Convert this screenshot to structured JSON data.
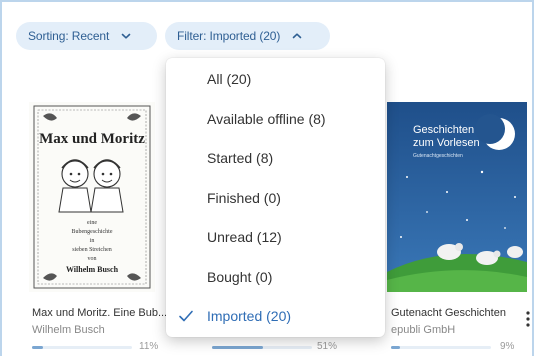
{
  "toolbar": {
    "sort_label": "Sorting: Recent",
    "filter_label": "Filter: Imported (20)"
  },
  "filter_menu": {
    "items": [
      {
        "label": "All (20)"
      },
      {
        "label": "Available offline (8)"
      },
      {
        "label": "Started (8)"
      },
      {
        "label": "Finished (0)"
      },
      {
        "label": "Unread (12)"
      },
      {
        "label": "Bought (0)"
      },
      {
        "label": "Imported (20)",
        "selected": true
      }
    ]
  },
  "books": [
    {
      "title": "Max und Moritz. Eine Bub...",
      "author": "Wilhelm Busch",
      "progress": 0.11,
      "progress_text": "11%",
      "cover": {
        "title": "Max und Moritz",
        "subtitle_lines": [
          "eine",
          "Bubengeschichte",
          "in",
          "sieben Streichen",
          "von"
        ],
        "author": "Wilhelm Busch"
      }
    },
    {
      "title": "",
      "author": "",
      "progress": 0.51,
      "progress_text": "51%"
    },
    {
      "title": "Gutenacht Geschichten",
      "author": "epubli GmbH",
      "progress": 0.09,
      "progress_text": "9%",
      "cover": {
        "title_lines": [
          "Geschichten",
          "zum Vorlesen"
        ],
        "subtitle": "Gutenachtgeschichten"
      }
    }
  ],
  "colors": {
    "accent": "#2f6db5",
    "chip_bg": "#e3eef9",
    "chip_text": "#2f5f93",
    "frame_border": "#bcd5ec",
    "progress_fill": "#7ba6d1"
  },
  "icons": {
    "sort_chevron": "chevron-down-icon",
    "filter_chevron": "chevron-up-icon",
    "selected_mark": "check-icon",
    "more": "more-vertical-icon"
  }
}
